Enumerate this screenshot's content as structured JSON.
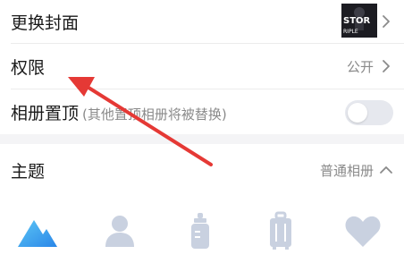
{
  "settings": {
    "cover": {
      "label": "更换封面",
      "thumb_text_top": "STOR",
      "thumb_text_bottom": "RIPLE"
    },
    "permission": {
      "label": "权限",
      "value": "公开"
    },
    "pin_top": {
      "label": "相册置顶",
      "hint": "(其他置顶相册将被替换)",
      "enabled": false
    },
    "theme": {
      "label": "主题",
      "value": "普通相册"
    }
  },
  "theme_icons": [
    {
      "name": "mountain-icon",
      "selected": true
    },
    {
      "name": "person-icon",
      "selected": false
    },
    {
      "name": "baby-bottle-icon",
      "selected": false
    },
    {
      "name": "luggage-icon",
      "selected": false
    },
    {
      "name": "heart-icon",
      "selected": false
    }
  ],
  "colors": {
    "accent": "#3aa0f0",
    "icon_inactive": "#c9d1e0",
    "arrow": "#e53935"
  }
}
